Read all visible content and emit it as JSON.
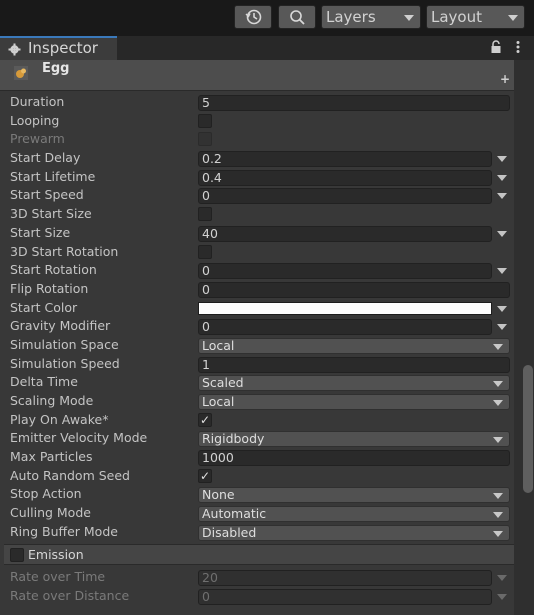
{
  "toolbar": {
    "layers_label": "Layers",
    "layout_label": "Layout"
  },
  "tab": {
    "label": "Inspector"
  },
  "object": {
    "name": "Egg"
  },
  "fields": [
    {
      "label": "Duration",
      "kind": "number",
      "value": "5"
    },
    {
      "label": "Looping",
      "kind": "checkbox",
      "checked": false
    },
    {
      "label": "Prewarm",
      "kind": "checkbox",
      "checked": false,
      "disabled": true
    },
    {
      "label": "Start Delay",
      "kind": "number-menu",
      "value": "0.2"
    },
    {
      "label": "Start Lifetime",
      "kind": "number-menu",
      "value": "0.4"
    },
    {
      "label": "Start Speed",
      "kind": "number-menu",
      "value": "0"
    },
    {
      "label": "3D Start Size",
      "kind": "checkbox",
      "checked": false
    },
    {
      "label": "Start Size",
      "kind": "number-menu",
      "value": "40"
    },
    {
      "label": "3D Start Rotation",
      "kind": "checkbox",
      "checked": false
    },
    {
      "label": "Start Rotation",
      "kind": "number-menu",
      "value": "0"
    },
    {
      "label": "Flip Rotation",
      "kind": "number",
      "value": "0"
    },
    {
      "label": "Start Color",
      "kind": "color",
      "value": "#ffffff"
    },
    {
      "label": "Gravity Modifier",
      "kind": "number-menu",
      "value": "0"
    },
    {
      "label": "Simulation Space",
      "kind": "dropdown",
      "value": "Local"
    },
    {
      "label": "Simulation Speed",
      "kind": "number",
      "value": "1"
    },
    {
      "label": "Delta Time",
      "kind": "dropdown",
      "value": "Scaled"
    },
    {
      "label": "Scaling Mode",
      "kind": "dropdown",
      "value": "Local"
    },
    {
      "label": "Play On Awake*",
      "kind": "checkbox",
      "checked": true
    },
    {
      "label": "Emitter Velocity Mode",
      "kind": "dropdown",
      "value": "Rigidbody"
    },
    {
      "label": "Max Particles",
      "kind": "number",
      "value": "1000"
    },
    {
      "label": "Auto Random Seed",
      "kind": "checkbox",
      "checked": true
    },
    {
      "label": "Stop Action",
      "kind": "dropdown",
      "value": "None"
    },
    {
      "label": "Culling Mode",
      "kind": "dropdown",
      "value": "Automatic"
    },
    {
      "label": "Ring Buffer Mode",
      "kind": "dropdown",
      "value": "Disabled"
    }
  ],
  "emission": {
    "label": "Emission",
    "enabled": false,
    "fields": [
      {
        "label": "Rate over Time",
        "kind": "number-menu",
        "value": "20",
        "disabled": true
      },
      {
        "label": "Rate over Distance",
        "kind": "number-menu",
        "value": "0",
        "disabled": true
      }
    ]
  },
  "colors": {
    "background": "#383838",
    "accent": "#3a79bb"
  }
}
